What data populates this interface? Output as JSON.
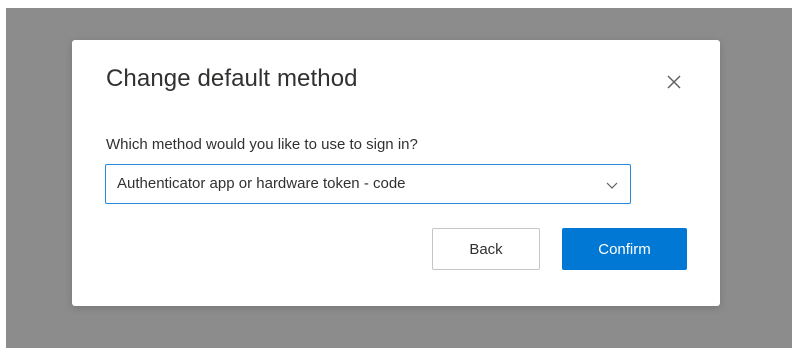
{
  "dialog": {
    "title": "Change default method",
    "close_icon": "close-icon",
    "prompt": "Which method would you like to use to sign in?",
    "method_select": {
      "selected_value": "Authenticator app or hardware token - code",
      "icon": "chevron-down-icon"
    },
    "buttons": {
      "back_label": "Back",
      "confirm_label": "Confirm"
    }
  },
  "colors": {
    "accent": "#0078d4",
    "focus_border": "#2b88d8",
    "overlay": "#8c8c8c",
    "text": "#323130"
  }
}
